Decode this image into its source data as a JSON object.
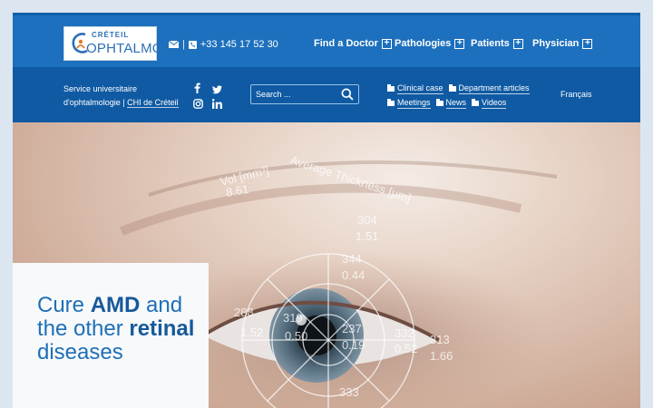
{
  "logo": {
    "line1": "CRÉTEIL",
    "line2": "OPHTALMO"
  },
  "contact": {
    "phone": "+33 145 17 52 30",
    "separator": "|"
  },
  "nav": [
    {
      "label": "Find a Doctor"
    },
    {
      "label": "Pathologies"
    },
    {
      "label": "Patients"
    },
    {
      "label": "Physician"
    }
  ],
  "service": {
    "line1": "Service universitaire",
    "line2_text": "d'ophtalmologie | ",
    "line2_link": "CHI de Créteil"
  },
  "search": {
    "placeholder": "Search ..."
  },
  "categories": [
    {
      "label": "Clinical case"
    },
    {
      "label": "Department articles"
    },
    {
      "label": "Meetings"
    },
    {
      "label": "News"
    },
    {
      "label": "Videos"
    }
  ],
  "language": "Français",
  "hero": {
    "title_part1": "Cure ",
    "title_bold1": "AMD",
    "title_part2": " and the other ",
    "title_bold2": "retinal",
    "title_part3": " diseases"
  },
  "overlay_text": {
    "header1": "Vol [mm³]",
    "header2": "Average Thickness [µm]",
    "n_861": "8.61",
    "n_304": "304",
    "n_151": "1.51",
    "n_344": "344",
    "n_044": "0.44",
    "n_288": "288",
    "n_152": "1.52",
    "n_319": "319",
    "n_050": "0.50",
    "n_237": "237",
    "n_019": "0.19",
    "n_332": "332",
    "n_052": "0.52",
    "n_313": "313",
    "n_166": "1.66",
    "n_333": "333"
  },
  "colors": {
    "top_bar": "#1d70bd",
    "sub_bar": "#0f5aa3",
    "hero_title": "#1e6fb8"
  },
  "icons": [
    "envelope-icon",
    "phone-icon",
    "plus-icon",
    "facebook-icon",
    "twitter-icon",
    "instagram-icon",
    "linkedin-icon",
    "search-icon",
    "folder-icon"
  ]
}
